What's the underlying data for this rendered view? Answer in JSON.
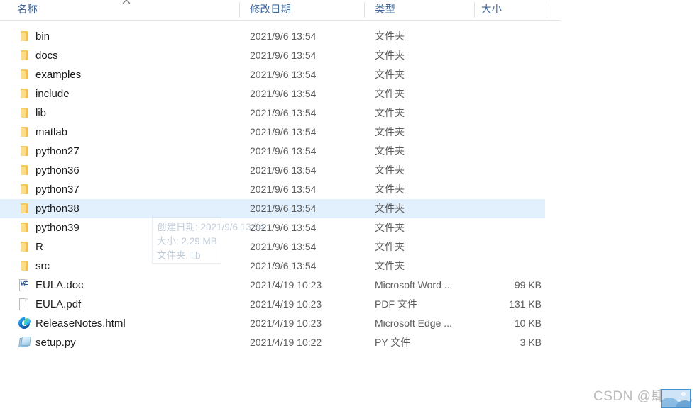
{
  "header": {
    "columns": [
      {
        "key": "name",
        "label": "名称",
        "sorted": true,
        "sort_direction": "asc"
      },
      {
        "key": "date",
        "label": "修改日期"
      },
      {
        "key": "type",
        "label": "类型"
      },
      {
        "key": "size",
        "label": "大小"
      }
    ]
  },
  "rows": [
    {
      "icon": "folder-icon",
      "name": "bin",
      "date": "2021/9/6 13:54",
      "type": "文件夹",
      "size": "",
      "selected": false
    },
    {
      "icon": "folder-icon",
      "name": "docs",
      "date": "2021/9/6 13:54",
      "type": "文件夹",
      "size": "",
      "selected": false
    },
    {
      "icon": "folder-icon",
      "name": "examples",
      "date": "2021/9/6 13:54",
      "type": "文件夹",
      "size": "",
      "selected": false
    },
    {
      "icon": "folder-icon",
      "name": "include",
      "date": "2021/9/6 13:54",
      "type": "文件夹",
      "size": "",
      "selected": false
    },
    {
      "icon": "folder-icon",
      "name": "lib",
      "date": "2021/9/6 13:54",
      "type": "文件夹",
      "size": "",
      "selected": false
    },
    {
      "icon": "folder-icon",
      "name": "matlab",
      "date": "2021/9/6 13:54",
      "type": "文件夹",
      "size": "",
      "selected": false
    },
    {
      "icon": "folder-icon",
      "name": "python27",
      "date": "2021/9/6 13:54",
      "type": "文件夹",
      "size": "",
      "selected": false
    },
    {
      "icon": "folder-icon",
      "name": "python36",
      "date": "2021/9/6 13:54",
      "type": "文件夹",
      "size": "",
      "selected": false
    },
    {
      "icon": "folder-icon",
      "name": "python37",
      "date": "2021/9/6 13:54",
      "type": "文件夹",
      "size": "",
      "selected": false
    },
    {
      "icon": "folder-icon",
      "name": "python38",
      "date": "2021/9/6 13:54",
      "type": "文件夹",
      "size": "",
      "selected": true
    },
    {
      "icon": "folder-icon",
      "name": "python39",
      "date": "2021/9/6 13:54",
      "type": "文件夹",
      "size": "",
      "selected": false
    },
    {
      "icon": "folder-icon",
      "name": "R",
      "date": "2021/9/6 13:54",
      "type": "文件夹",
      "size": "",
      "selected": false
    },
    {
      "icon": "folder-icon",
      "name": "src",
      "date": "2021/9/6 13:54",
      "type": "文件夹",
      "size": "",
      "selected": false
    },
    {
      "icon": "word-doc-icon",
      "name": "EULA.doc",
      "date": "2021/4/19 10:23",
      "type": "Microsoft Word ...",
      "size": "99 KB",
      "selected": false
    },
    {
      "icon": "pdf-file-icon",
      "name": "EULA.pdf",
      "date": "2021/4/19 10:23",
      "type": "PDF 文件",
      "size": "131 KB",
      "selected": false
    },
    {
      "icon": "edge-browser-icon",
      "name": "ReleaseNotes.html",
      "date": "2021/4/19 10:23",
      "type": "Microsoft Edge ...",
      "size": "10 KB",
      "selected": false
    },
    {
      "icon": "python-file-icon",
      "name": "setup.py",
      "date": "2021/4/19 10:22",
      "type": "PY 文件",
      "size": "3 KB",
      "selected": false
    }
  ],
  "tooltip": {
    "lines": [
      "创建日期: 2021/9/6 13:54",
      "大小: 2.29 MB",
      "文件夹: lib"
    ]
  },
  "watermark": {
    "text": "CSDN @肆月风"
  },
  "colors": {
    "selection": "#e2effc",
    "header_text": "#41699c",
    "folder": "#f3c960",
    "word_blue": "#2a5699",
    "edge_blue": "#1b86dd"
  }
}
